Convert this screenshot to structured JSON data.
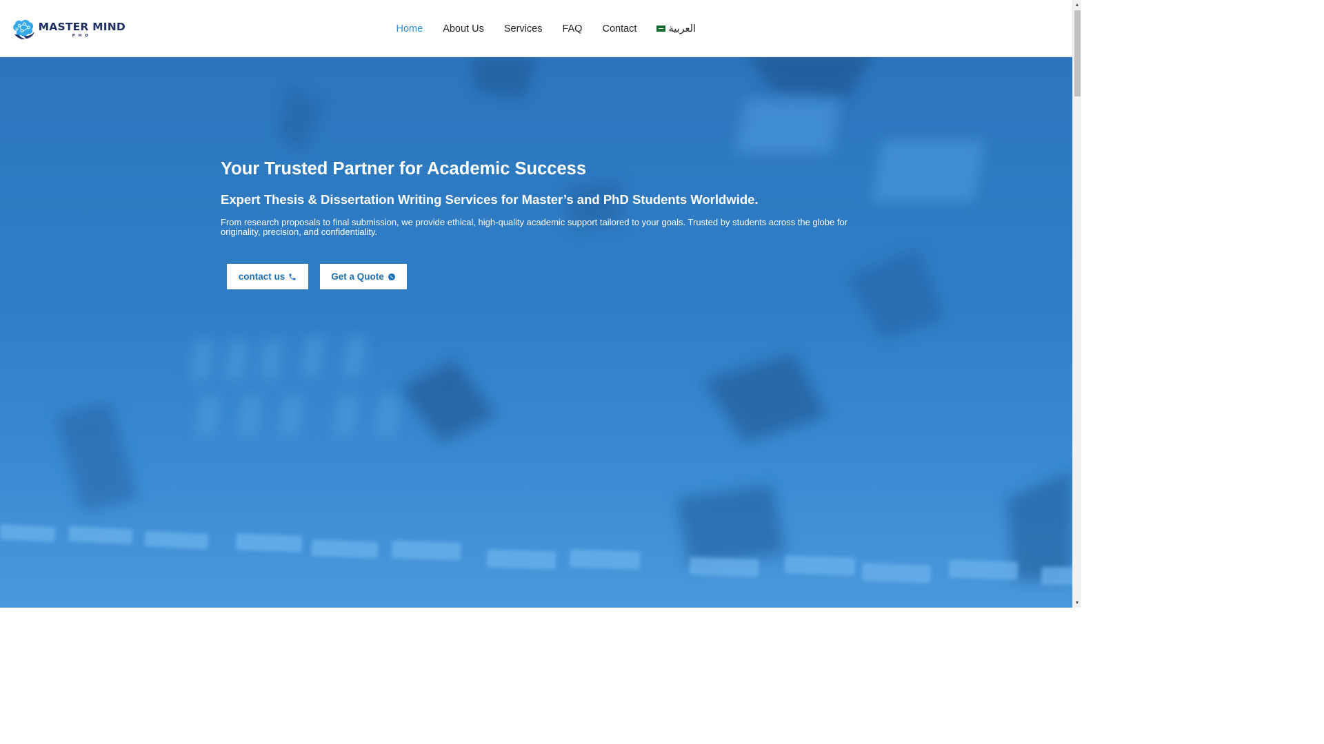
{
  "header": {
    "logo": {
      "word_master": "MASTER",
      "word_mind": "MIND",
      "sub": "PHD",
      "brand_dark": "#1d2f63",
      "brand_light": "#34a9e6"
    },
    "nav": [
      {
        "label": "Home",
        "active": true
      },
      {
        "label": "About Us",
        "active": false
      },
      {
        "label": "Services",
        "active": false
      },
      {
        "label": "FAQ",
        "active": false
      },
      {
        "label": "Contact",
        "active": false
      },
      {
        "label": "العربية",
        "active": false,
        "icon": "saudi-flag-icon"
      }
    ],
    "active_color": "#2a8fd6"
  },
  "hero": {
    "title": "Your Trusted Partner for Academic Success",
    "subtitle": "Expert Thesis & Dissertation Writing Services for Master’s and PhD Students Worldwide.",
    "description": "From research proposals to final submission, we provide ethical, high-quality academic support tailored to your goals. Trusted by students across the globe for originality, precision, and confidentiality.",
    "buttons": {
      "contact_label": "contact us",
      "contact_icon": "phone-icon",
      "quote_label": "Get a Quote",
      "quote_icon": "whatsapp-icon"
    },
    "overlay_color": "#2f7ec6",
    "button_text_color": "#1f6fb6"
  },
  "scrollbar": {
    "up_icon": "scroll-up-arrow-icon",
    "down_icon": "scroll-down-arrow-icon"
  }
}
